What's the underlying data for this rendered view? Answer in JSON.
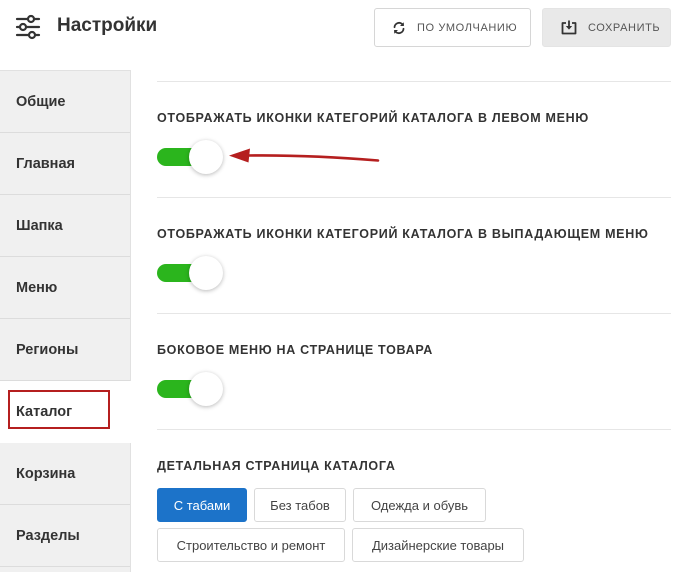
{
  "header": {
    "title": "Настройки",
    "icon": "sliders-icon",
    "default_button": {
      "label": "ПО УМОЛЧАНИЮ",
      "icon": "refresh-icon"
    },
    "save_button": {
      "label": "СОХРАНИТЬ",
      "icon": "save-icon"
    }
  },
  "sidebar": {
    "items": [
      {
        "label": "Общие"
      },
      {
        "label": "Главная"
      },
      {
        "label": "Шапка"
      },
      {
        "label": "Меню"
      },
      {
        "label": "Регионы"
      },
      {
        "label": "Каталог",
        "active": true
      },
      {
        "label": "Корзина"
      },
      {
        "label": "Разделы"
      }
    ]
  },
  "main": {
    "settings": [
      {
        "title": "ОТОБРАЖАТЬ ИКОНКИ КАТЕГОРИЙ КАТАЛОГА В ЛЕВОМ МЕНЮ",
        "enabled": true
      },
      {
        "title": "ОТОБРАЖАТЬ ИКОНКИ КАТЕГОРИЙ КАТАЛОГА В ВЫПАДАЮЩЕМ МЕНЮ",
        "enabled": true
      },
      {
        "title": "БОКОВОЕ МЕНЮ НА СТРАНИЦЕ ТОВАРА",
        "enabled": true
      }
    ],
    "detail_page": {
      "title": "ДЕТАЛЬНАЯ СТРАНИЦА КАТАЛОГА",
      "options": [
        {
          "label": "С табами",
          "selected": true
        },
        {
          "label": "Без табов",
          "selected": false
        },
        {
          "label": "Одежда и обувь",
          "selected": false
        },
        {
          "label": "Строительство и ремонт",
          "selected": false
        },
        {
          "label": "Дизайнерские товары",
          "selected": false
        }
      ]
    }
  },
  "colors": {
    "toggle_on": "#2bb51d",
    "selected_option": "#1c73c9",
    "annotation_arrow": "#b51f1f"
  }
}
